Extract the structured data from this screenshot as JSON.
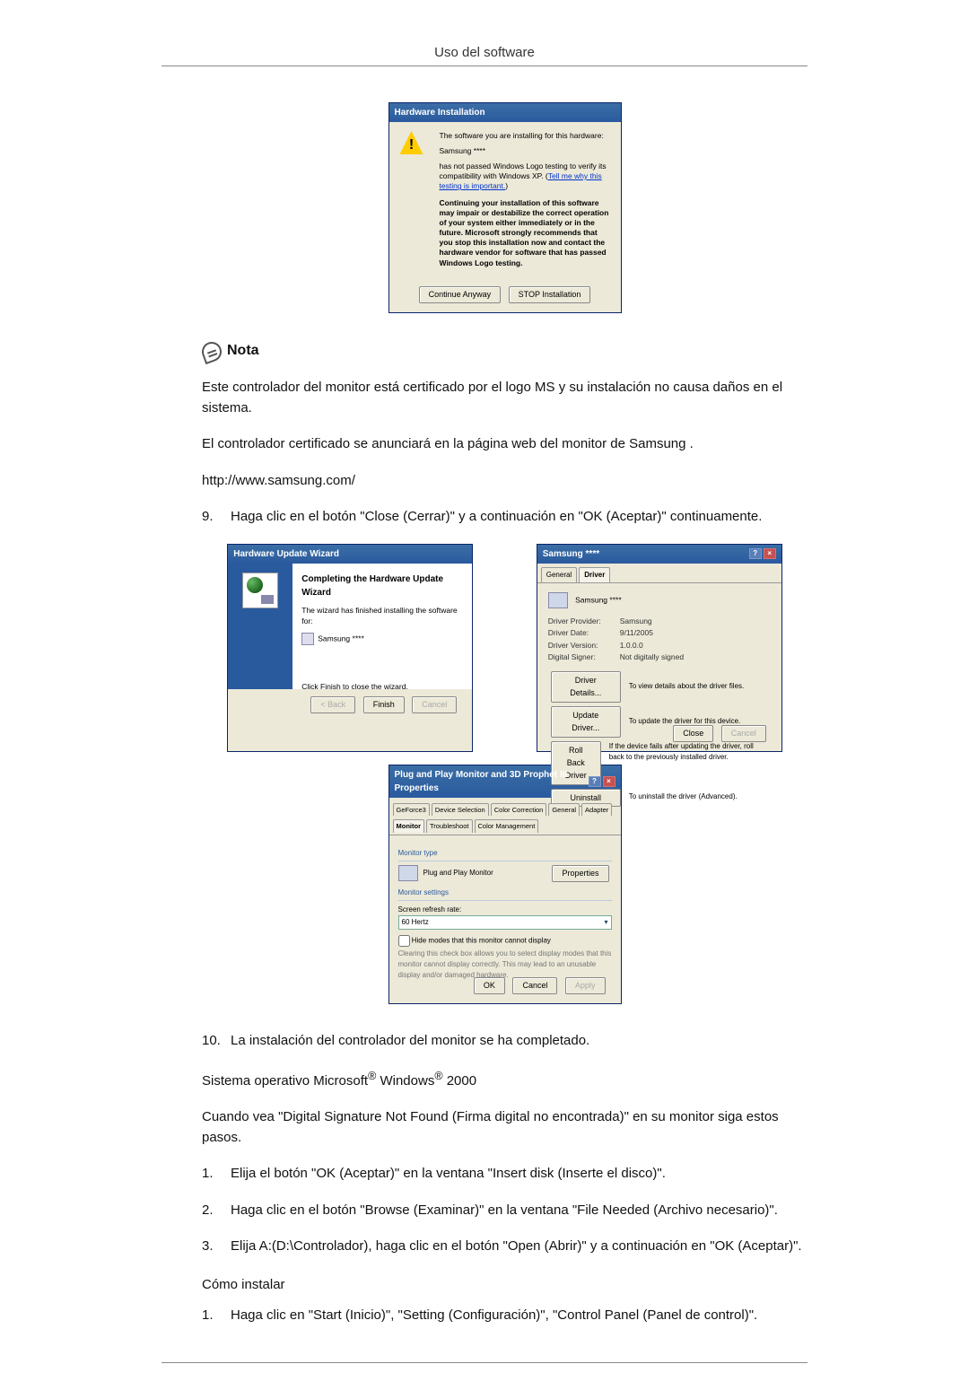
{
  "header": {
    "title": "Uso del software"
  },
  "hw_install": {
    "title": "Hardware Installation",
    "line1": "The software you are installing for this hardware:",
    "device": "Samsung ****",
    "line2a": "has not passed Windows Logo testing to verify its compatibility with Windows XP. (",
    "line2_link": "Tell me why this testing is important.",
    "line2b": ")",
    "warning": "Continuing your installation of this software may impair or destabilize the correct operation of your system either immediately or in the future. Microsoft strongly recommends that you stop this installation now and contact the hardware vendor for software that has passed Windows Logo testing.",
    "btn_continue": "Continue Anyway",
    "btn_stop": "STOP Installation"
  },
  "note": {
    "label": "Nota"
  },
  "note_para": "Este controlador del monitor está certificado por el logo MS y su instalación no causa daños en el sistema.",
  "cert_para": "El controlador certificado se anunciará en la página web del monitor de Samsung .",
  "url": "http://www.samsung.com/",
  "step9_num": "9.",
  "step9_text": "Haga clic en el botón \"Close (Cerrar)\" y a continuación en \"OK (Aceptar)\" continuamente.",
  "wizard": {
    "title": "Hardware Update Wizard",
    "heading": "Completing the Hardware Update Wizard",
    "sub": "The wizard has finished installing the software for:",
    "device": "Samsung ****",
    "finish_hint": "Click Finish to close the wizard.",
    "btn_back": "< Back",
    "btn_finish": "Finish",
    "btn_cancel": "Cancel"
  },
  "props": {
    "title": "Samsung ****",
    "tab_general": "General",
    "tab_driver": "Driver",
    "device": "Samsung ****",
    "rows": {
      "provider_l": "Driver Provider:",
      "provider_v": "Samsung",
      "date_l": "Driver Date:",
      "date_v": "9/11/2005",
      "version_l": "Driver Version:",
      "version_v": "1.0.0.0",
      "signer_l": "Digital Signer:",
      "signer_v": "Not digitally signed"
    },
    "btn_details": "Driver Details...",
    "details_desc": "To view details about the driver files.",
    "btn_update": "Update Driver...",
    "update_desc": "To update the driver for this device.",
    "btn_rollback": "Roll Back Driver",
    "rollback_desc": "If the device fails after updating the driver, roll back to the previously installed driver.",
    "btn_uninstall": "Uninstall",
    "uninstall_desc": "To uninstall the driver (Advanced).",
    "btn_close": "Close",
    "btn_cancel": "Cancel"
  },
  "pnp": {
    "title": "Plug and Play Monitor and 3D Prophet III Properties",
    "tabs": [
      "GeForce3",
      "Device Selection",
      "Color Correction",
      "General",
      "Adapter",
      "Monitor",
      "Troubleshoot",
      "Color Management"
    ],
    "group_type": "Monitor type",
    "type_val": "Plug and Play Monitor",
    "btn_properties": "Properties",
    "group_settings": "Monitor settings",
    "refresh_label": "Screen refresh rate:",
    "refresh_val": "60 Hertz",
    "hide_chk": "Hide modes that this monitor cannot display",
    "hide_desc": "Clearing this check box allows you to select display modes that this monitor cannot display correctly. This may lead to an unusable display and/or damaged hardware.",
    "btn_ok": "OK",
    "btn_cancel": "Cancel",
    "btn_apply": "Apply"
  },
  "step10_num": "10.",
  "step10_text": "La instalación del controlador del monitor se ha completado.",
  "os_line_a": "Sistema operativo Microsoft",
  "os_line_b": " Windows",
  "os_line_c": " 2000",
  "reg": "®",
  "sig_para": "Cuando vea \"Digital Signature Not Found (Firma digital no encontrada)\" en su monitor siga estos pasos.",
  "steps2000": [
    {
      "n": "1.",
      "t": "Elija el botón \"OK (Aceptar)\" en la ventana \"Insert disk (Inserte el disco)\"."
    },
    {
      "n": "2.",
      "t": "Haga clic en el botón \"Browse (Examinar)\" en la ventana \"File Needed (Archivo necesario)\"."
    },
    {
      "n": "3.",
      "t": "Elija A:(D:\\Controlador), haga clic en el botón \"Open (Abrir)\" y a continuación en \"OK (Aceptar)\"."
    }
  ],
  "howto": "Cómo instalar",
  "howto_steps": [
    {
      "n": "1.",
      "t": "Haga clic en \"Start (Inicio)\", \"Setting (Configuración)\", \"Control Panel (Panel de control)\"."
    }
  ]
}
